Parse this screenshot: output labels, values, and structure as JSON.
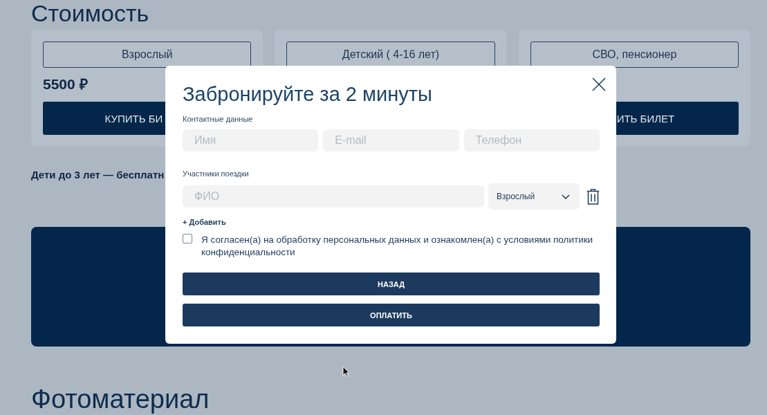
{
  "page": {
    "heading": "Стоимость",
    "note": "Дети до 3 лет — бесплатн",
    "section_heading": "Фотоматериал"
  },
  "price_cards": [
    {
      "category": "Взрослый",
      "price": "5500 ₽",
      "button": "КУПИТЬ БИ"
    },
    {
      "category": "Детский ( 4-16 лет)"
    },
    {
      "category": "СВО, пенсионер",
      "button": "ИТЬ БИЛЕТ"
    }
  ],
  "modal": {
    "title": "Забронируйте за 2 минуты",
    "contact_label": "Контактные данные",
    "contact_fields": [
      {
        "placeholder": "Имя"
      },
      {
        "placeholder": "E-mail"
      },
      {
        "placeholder": "Телефон"
      }
    ],
    "participants_label": "Участники поездки",
    "participants": [
      {
        "placeholder": "ФИО",
        "category": "Взрослый"
      }
    ],
    "add_link": "+ Добавить",
    "consent": {
      "checked": false,
      "text": "Я согласен(а) на обработку персональных данных и ознакомлен(а) с условиями политики конфиденциальности"
    },
    "buttons": [
      "НАЗАД",
      "ОПЛАТИТЬ"
    ]
  }
}
